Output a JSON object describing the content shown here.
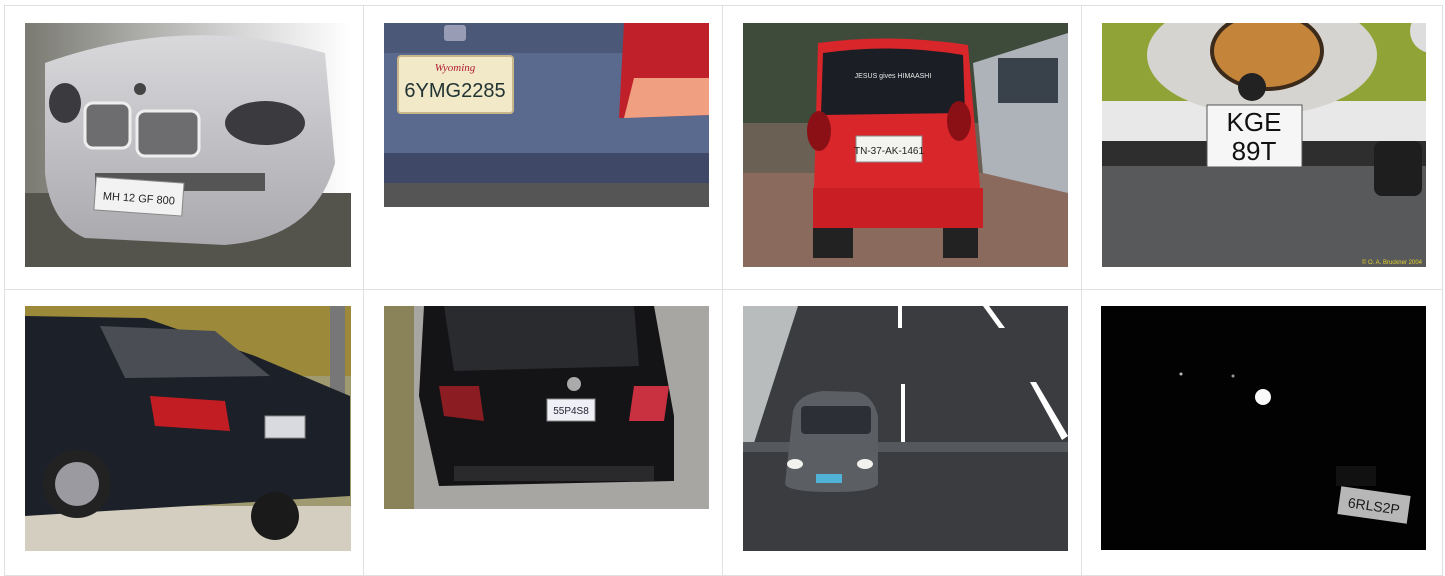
{
  "gallery": {
    "images": [
      {
        "plate": "MH 12 GF 800",
        "header": ""
      },
      {
        "plate": "6YMG2285",
        "header": "Wyoming"
      },
      {
        "plate": "TN-37-AK-1461",
        "header": "JESUS gives HIMAASHI"
      },
      {
        "plate_line1": "KGE",
        "plate_line2": "89T",
        "credit": "© O. A. Bruckner 2004"
      },
      {
        "plate": "",
        "header": ""
      },
      {
        "plate": "55P4S8",
        "header": ""
      },
      {
        "plate": "",
        "header": ""
      },
      {
        "plate": "6RLS2P",
        "header": ""
      }
    ]
  }
}
